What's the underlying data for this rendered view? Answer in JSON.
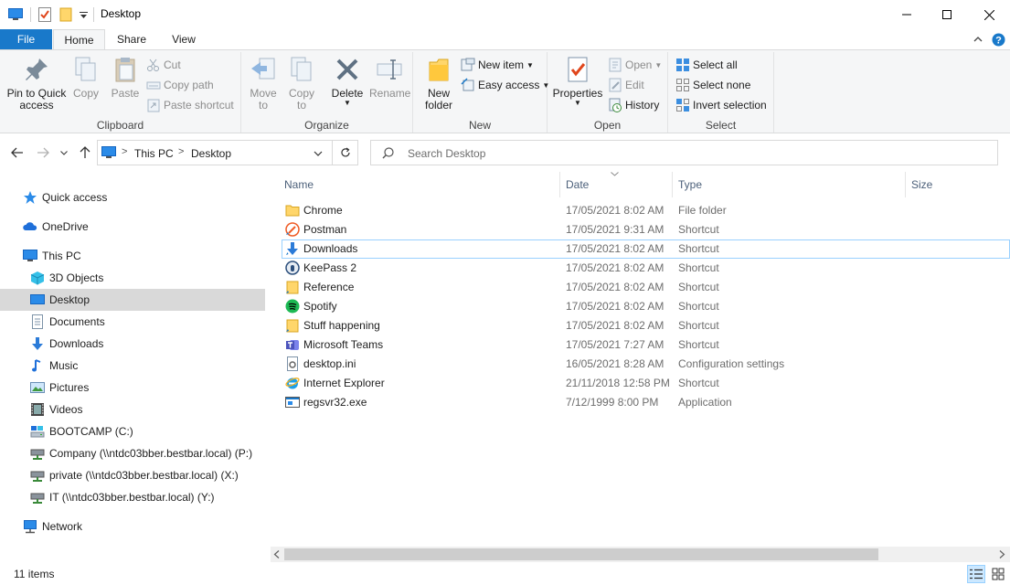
{
  "window": {
    "title": "Desktop"
  },
  "ribbon_tabs": [
    "File",
    "Home",
    "Share",
    "View"
  ],
  "ribbon": {
    "clipboard": {
      "label": "Clipboard",
      "pin_line1": "Pin to Quick",
      "pin_line2": "access",
      "copy": "Copy",
      "paste": "Paste",
      "cut": "Cut",
      "copy_path": "Copy path",
      "paste_shortcut": "Paste shortcut"
    },
    "organize": {
      "label": "Organize",
      "move_line1": "Move",
      "move_line2": "to",
      "copy_line1": "Copy",
      "copy_line2": "to",
      "delete": "Delete",
      "rename": "Rename"
    },
    "new": {
      "label": "New",
      "folder_line1": "New",
      "folder_line2": "folder",
      "new_item": "New item",
      "easy_access": "Easy access"
    },
    "open": {
      "label": "Open",
      "properties": "Properties",
      "open": "Open",
      "edit": "Edit",
      "history": "History"
    },
    "select": {
      "label": "Select",
      "select_all": "Select all",
      "select_none": "Select none",
      "invert": "Invert selection"
    }
  },
  "address": {
    "root": "This PC",
    "current": "Desktop"
  },
  "search": {
    "placeholder": "Search Desktop"
  },
  "nav": {
    "items": [
      {
        "label": "Quick access",
        "icon": "star-icon"
      },
      {
        "label": "OneDrive",
        "icon": "cloud-icon"
      },
      {
        "label": "This PC",
        "icon": "computer-icon"
      },
      {
        "label": "3D Objects",
        "icon": "cube-icon"
      },
      {
        "label": "Desktop",
        "icon": "desktop-icon",
        "selected": true
      },
      {
        "label": "Documents",
        "icon": "document-icon"
      },
      {
        "label": "Downloads",
        "icon": "download-icon"
      },
      {
        "label": "Music",
        "icon": "music-icon"
      },
      {
        "label": "Pictures",
        "icon": "picture-icon"
      },
      {
        "label": "Videos",
        "icon": "video-icon"
      },
      {
        "label": "BOOTCAMP (C:)",
        "icon": "drive-icon"
      },
      {
        "label": "Company (\\\\ntdc03bber.bestbar.local) (P:)",
        "icon": "network-drive-icon"
      },
      {
        "label": "private (\\\\ntdc03bber.bestbar.local) (X:)",
        "icon": "network-drive-icon"
      },
      {
        "label": "IT (\\\\ntdc03bber.bestbar.local) (Y:)",
        "icon": "network-drive-icon"
      },
      {
        "label": "Network",
        "icon": "network-icon"
      }
    ]
  },
  "columns": {
    "name": "Name",
    "date": "Date",
    "type": "Type",
    "size": "Size"
  },
  "files": [
    {
      "name": "Chrome",
      "date": "17/05/2021 8:02 AM",
      "type": "File folder",
      "icon": "folder-icon"
    },
    {
      "name": "Postman",
      "date": "17/05/2021 9:31 AM",
      "type": "Shortcut",
      "icon": "postman-icon"
    },
    {
      "name": "Downloads",
      "date": "17/05/2021 8:02 AM",
      "type": "Shortcut",
      "icon": "download-icon"
    },
    {
      "name": "KeePass 2",
      "date": "17/05/2021 8:02 AM",
      "type": "Shortcut",
      "icon": "keepass-icon"
    },
    {
      "name": "Reference",
      "date": "17/05/2021 8:02 AM",
      "type": "Shortcut",
      "icon": "folder-shortcut-icon"
    },
    {
      "name": "Spotify",
      "date": "17/05/2021 8:02 AM",
      "type": "Shortcut",
      "icon": "spotify-icon"
    },
    {
      "name": "Stuff happening",
      "date": "17/05/2021 8:02 AM",
      "type": "Shortcut",
      "icon": "folder-shortcut-icon"
    },
    {
      "name": "Microsoft Teams",
      "date": "17/05/2021 7:27 AM",
      "type": "Shortcut",
      "icon": "teams-icon"
    },
    {
      "name": "desktop.ini",
      "date": "16/05/2021 8:28 AM",
      "type": "Configuration settings",
      "icon": "settings-file-icon"
    },
    {
      "name": "Internet Explorer",
      "date": "21/11/2018 12:58 PM",
      "type": "Shortcut",
      "icon": "ie-icon"
    },
    {
      "name": "regsvr32.exe",
      "date": "7/12/1999 8:00 PM",
      "type": "Application",
      "icon": "exe-icon"
    }
  ],
  "status": {
    "count": "11 items"
  },
  "colors": {
    "accent": "#1979ca",
    "selection": "#d9d9d9",
    "focus_border": "#99d1ff",
    "folder": "#ffd66b"
  }
}
